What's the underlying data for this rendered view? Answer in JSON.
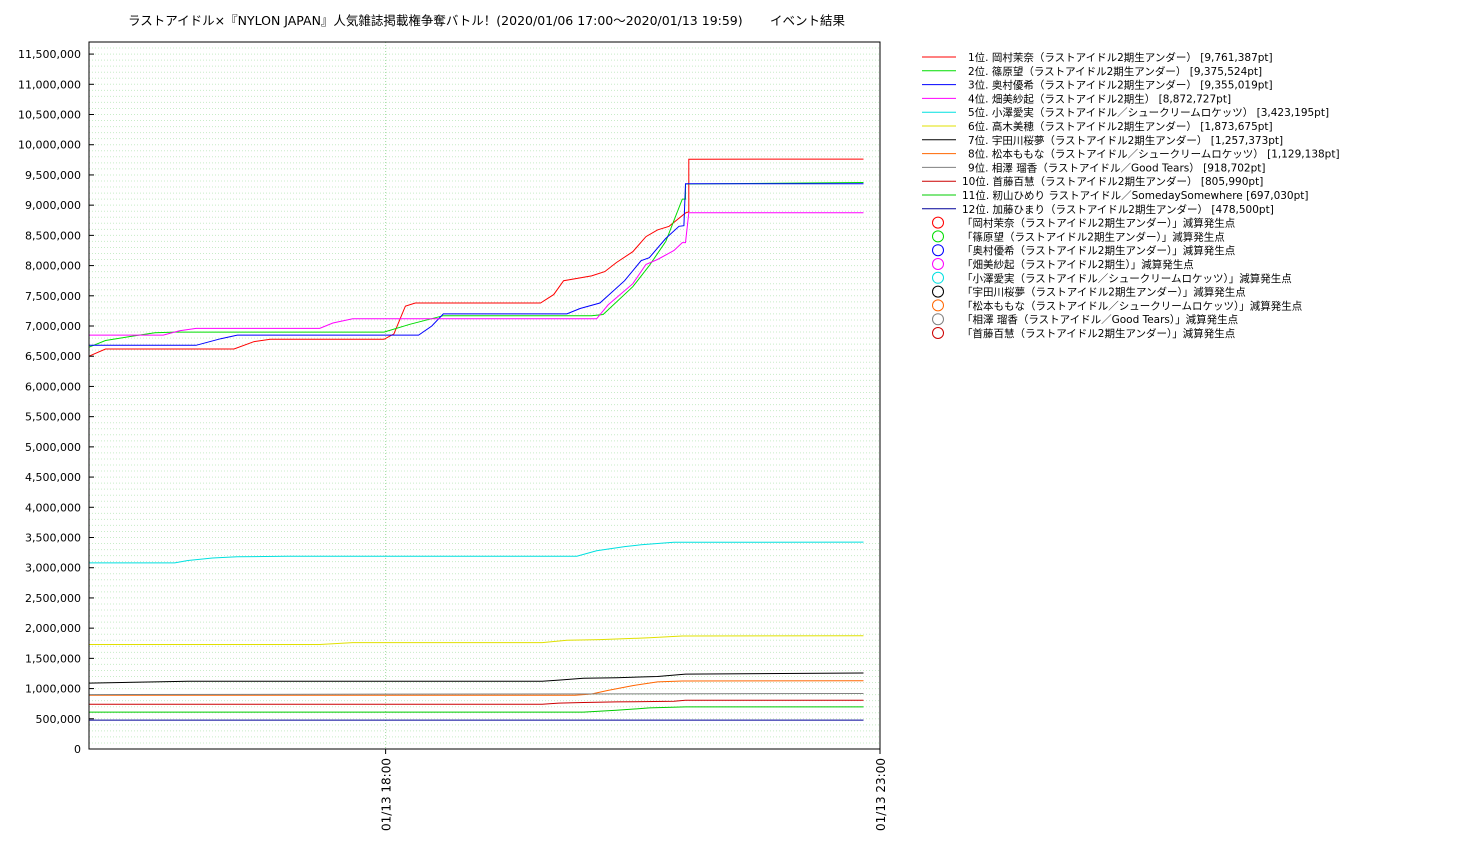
{
  "chart_data": {
    "type": "line",
    "title": "ラストアイドル×『NYLON JAPAN』人気雑誌掲載権争奪バトル！(2020/01/06 17:00〜2020/01/13 19:59)",
    "subtitle": "イベント結果",
    "xlabel": "",
    "ylabel": "",
    "x_unit": "minutes after 01/13 15:00",
    "xlim": [
      0,
      480
    ],
    "x_ticks": [
      {
        "x": 180,
        "label": "01/13 18:00"
      },
      {
        "x": 480,
        "label": "01/13 23:00"
      }
    ],
    "ylim": [
      0,
      11700000
    ],
    "y_ticks": [
      "0",
      "500,000",
      "1,000,000",
      "1,500,000",
      "2,000,000",
      "2,500,000",
      "3,000,000",
      "3,500,000",
      "4,000,000",
      "4,500,000",
      "5,000,000",
      "5,500,000",
      "6,000,000",
      "6,500,000",
      "7,000,000",
      "7,500,000",
      "8,000,000",
      "8,500,000",
      "9,000,000",
      "9,500,000",
      "10,000,000",
      "10,500,000",
      "11,000,000",
      "11,500,000"
    ],
    "grid": true,
    "legend_position": "right",
    "series": [
      {
        "name": "1位. 岡村茉奈（ラストアイドル2期生アンダー） [9,761,387pt]",
        "color": "#ff0000",
        "points": [
          [
            0,
            6500000
          ],
          [
            10,
            6620000
          ],
          [
            88,
            6620000
          ],
          [
            100,
            6740000
          ],
          [
            110,
            6780000
          ],
          [
            179,
            6780000
          ],
          [
            185,
            6870000
          ],
          [
            192,
            7330000
          ],
          [
            198,
            7380000
          ],
          [
            274,
            7380000
          ],
          [
            282,
            7520000
          ],
          [
            288,
            7750000
          ],
          [
            305,
            7830000
          ],
          [
            313,
            7900000
          ],
          [
            320,
            8050000
          ],
          [
            330,
            8230000
          ],
          [
            338,
            8480000
          ],
          [
            345,
            8590000
          ],
          [
            352,
            8650000
          ],
          [
            362,
            8870000
          ],
          [
            364,
            8890000
          ],
          [
            364,
            9760000
          ],
          [
            470,
            9761387
          ]
        ]
      },
      {
        "name": "2位. 篠原望（ラストアイドル2期生アンダー） [9,375,524pt]",
        "color": "#00dd00",
        "points": [
          [
            0,
            6650000
          ],
          [
            10,
            6760000
          ],
          [
            28,
            6840000
          ],
          [
            40,
            6890000
          ],
          [
            52,
            6900000
          ],
          [
            179,
            6900000
          ],
          [
            195,
            7030000
          ],
          [
            215,
            7170000
          ],
          [
            305,
            7170000
          ],
          [
            312,
            7190000
          ],
          [
            330,
            7650000
          ],
          [
            340,
            8000000
          ],
          [
            350,
            8400000
          ],
          [
            360,
            9100000
          ],
          [
            362,
            9100000
          ],
          [
            362,
            9350000
          ],
          [
            470,
            9375524
          ]
        ]
      },
      {
        "name": "3位. 奥村優希（ラストアイドル2期生アンダー） [9,355,019pt]",
        "color": "#0000ff",
        "points": [
          [
            0,
            6680000
          ],
          [
            65,
            6680000
          ],
          [
            80,
            6790000
          ],
          [
            90,
            6850000
          ],
          [
            200,
            6850000
          ],
          [
            208,
            7000000
          ],
          [
            215,
            7200000
          ],
          [
            290,
            7200000
          ],
          [
            298,
            7290000
          ],
          [
            310,
            7380000
          ],
          [
            325,
            7750000
          ],
          [
            335,
            8080000
          ],
          [
            340,
            8130000
          ],
          [
            350,
            8450000
          ],
          [
            358,
            8650000
          ],
          [
            361,
            8660000
          ],
          [
            362,
            9355019
          ],
          [
            470,
            9355019
          ]
        ]
      },
      {
        "name": "4位. 畑美紗起（ラストアイドル2期生） [8,872,727pt]",
        "color": "#ff00ff",
        "points": [
          [
            0,
            6850000
          ],
          [
            45,
            6850000
          ],
          [
            55,
            6920000
          ],
          [
            65,
            6960000
          ],
          [
            140,
            6960000
          ],
          [
            148,
            7050000
          ],
          [
            160,
            7120000
          ],
          [
            308,
            7120000
          ],
          [
            315,
            7350000
          ],
          [
            330,
            7700000
          ],
          [
            338,
            8020000
          ],
          [
            345,
            8100000
          ],
          [
            355,
            8250000
          ],
          [
            360,
            8380000
          ],
          [
            362,
            8380000
          ],
          [
            364,
            8872727
          ],
          [
            470,
            8872727
          ]
        ]
      },
      {
        "name": "5位. 小澤愛実（ラストアイドル／シュークリームロケッツ） [3,423,195pt]",
        "color": "#00e0e0",
        "points": [
          [
            0,
            3080000
          ],
          [
            52,
            3080000
          ],
          [
            60,
            3120000
          ],
          [
            75,
            3160000
          ],
          [
            90,
            3180000
          ],
          [
            120,
            3190000
          ],
          [
            296,
            3190000
          ],
          [
            308,
            3280000
          ],
          [
            325,
            3350000
          ],
          [
            335,
            3380000
          ],
          [
            355,
            3420000
          ],
          [
            470,
            3423195
          ]
        ]
      },
      {
        "name": "6位. 高木美穂（ラストアイドル2期生アンダー） [1,873,675pt]",
        "color": "#e0e000",
        "points": [
          [
            0,
            1730000
          ],
          [
            140,
            1730000
          ],
          [
            160,
            1760000
          ],
          [
            275,
            1760000
          ],
          [
            290,
            1800000
          ],
          [
            310,
            1810000
          ],
          [
            340,
            1840000
          ],
          [
            360,
            1870000
          ],
          [
            470,
            1873675
          ]
        ]
      },
      {
        "name": "7位. 宇田川桜夢（ラストアイドル2期生アンダー） [1,257,373pt]",
        "color": "#000000",
        "points": [
          [
            0,
            1090000
          ],
          [
            20,
            1100000
          ],
          [
            40,
            1110000
          ],
          [
            60,
            1120000
          ],
          [
            275,
            1120000
          ],
          [
            285,
            1140000
          ],
          [
            300,
            1170000
          ],
          [
            320,
            1180000
          ],
          [
            345,
            1200000
          ],
          [
            362,
            1240000
          ],
          [
            470,
            1257373
          ]
        ]
      },
      {
        "name": "8位. 松本ももな（ラストアイドル／シュークリームロケッツ） [1,129,138pt]",
        "color": "#ff6600",
        "points": [
          [
            0,
            890000
          ],
          [
            295,
            890000
          ],
          [
            305,
            910000
          ],
          [
            315,
            970000
          ],
          [
            330,
            1050000
          ],
          [
            345,
            1110000
          ],
          [
            360,
            1125000
          ],
          [
            470,
            1129138
          ]
        ]
      },
      {
        "name": "9位. 相澤 瑠香（ラストアイドル／Good Tears） [918,702pt]",
        "color": "#808080",
        "points": [
          [
            0,
            900000
          ],
          [
            470,
            918702
          ]
        ]
      },
      {
        "name": "10位. 首藤百慧（ラストアイドル2期生アンダー） [805,990pt]",
        "color": "#cc0000",
        "points": [
          [
            0,
            740000
          ],
          [
            275,
            740000
          ],
          [
            285,
            760000
          ],
          [
            300,
            770000
          ],
          [
            320,
            780000
          ],
          [
            355,
            790000
          ],
          [
            362,
            805990
          ],
          [
            470,
            805990
          ]
        ]
      },
      {
        "name": "11位. 籾山ひめり ラストアイドル／SomedaySomewhere [697,030pt]",
        "color": "#00cc00",
        "points": [
          [
            0,
            610000
          ],
          [
            300,
            610000
          ],
          [
            320,
            640000
          ],
          [
            340,
            680000
          ],
          [
            362,
            697030
          ],
          [
            470,
            697030
          ]
        ]
      },
      {
        "name": "12位. 加藤ひまり（ラストアイドル2期生アンダー） [478,500pt]",
        "color": "#000099",
        "points": [
          [
            0,
            478500
          ],
          [
            470,
            478500
          ]
        ]
      }
    ],
    "markers_legend": [
      {
        "label": "「岡村茉奈（ラストアイドル2期生アンダー）」減算発生点",
        "color": "#ff0000"
      },
      {
        "label": "「篠原望（ラストアイドル2期生アンダー）」減算発生点",
        "color": "#00dd00"
      },
      {
        "label": "「奥村優希（ラストアイドル2期生アンダー）」減算発生点",
        "color": "#0000ff"
      },
      {
        "label": "「畑美紗起（ラストアイドル2期生）」減算発生点",
        "color": "#ff00ff"
      },
      {
        "label": "「小澤愛実（ラストアイドル／シュークリームロケッツ）」減算発生点",
        "color": "#00e0e0"
      },
      {
        "label": "「宇田川桜夢（ラストアイドル2期生アンダー）」減算発生点",
        "color": "#000000"
      },
      {
        "label": "「松本ももな（ラストアイドル／シュークリームロケッツ）」減算発生点",
        "color": "#ff6600"
      },
      {
        "label": "「相澤 瑠香（ラストアイドル／Good Tears）」減算発生点",
        "color": "#808080"
      },
      {
        "label": "「首藤百慧（ラストアイドル2期生アンダー）」減算発生点",
        "color": "#cc0000"
      }
    ]
  }
}
